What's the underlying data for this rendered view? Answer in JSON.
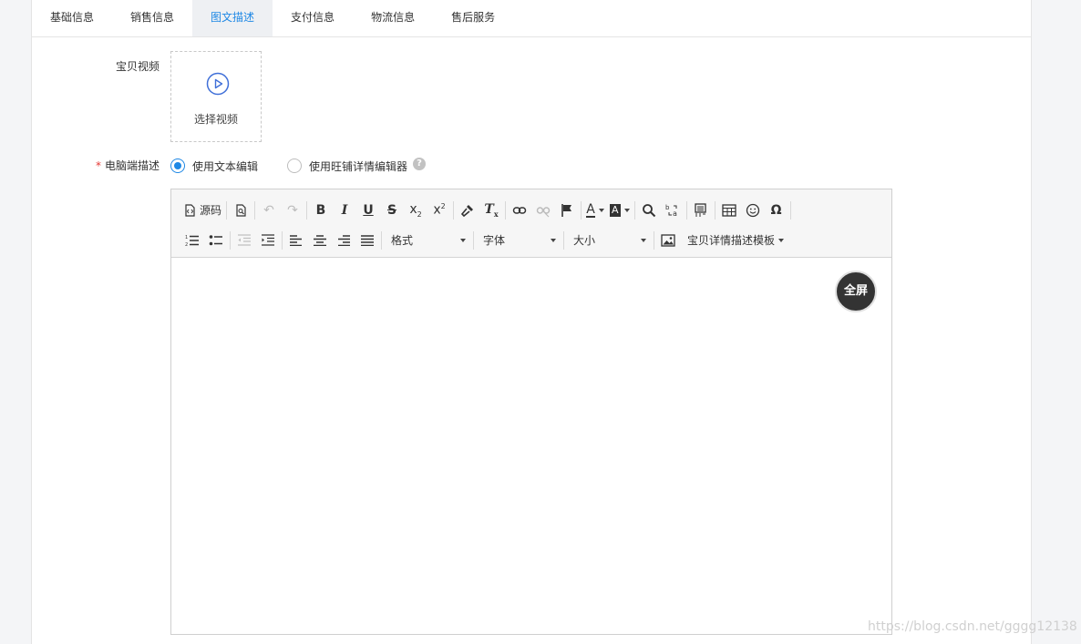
{
  "tabs": [
    {
      "label": "基础信息",
      "active": false
    },
    {
      "label": "销售信息",
      "active": false
    },
    {
      "label": "图文描述",
      "active": true
    },
    {
      "label": "支付信息",
      "active": false
    },
    {
      "label": "物流信息",
      "active": false
    },
    {
      "label": "售后服务",
      "active": false
    }
  ],
  "video": {
    "label": "宝贝视频",
    "button_text": "选择视频",
    "icon": "play-circle-icon"
  },
  "description": {
    "required_mark": "*",
    "label": "电脑端描述",
    "options": [
      {
        "label": "使用文本编辑",
        "checked": true
      },
      {
        "label": "使用旺铺详情编辑器",
        "checked": false
      }
    ],
    "help_glyph": "?"
  },
  "editor": {
    "source_label": "源码",
    "format_label": "格式",
    "font_label": "字体",
    "size_label": "大小",
    "template_label": "宝贝详情描述模板",
    "fullscreen_label": "全屏"
  },
  "watermark": "https://blog.csdn.net/gggg12138",
  "colors": {
    "accent": "#1e88e5",
    "required": "#e53935",
    "fullscreen_bg": "#333333"
  }
}
